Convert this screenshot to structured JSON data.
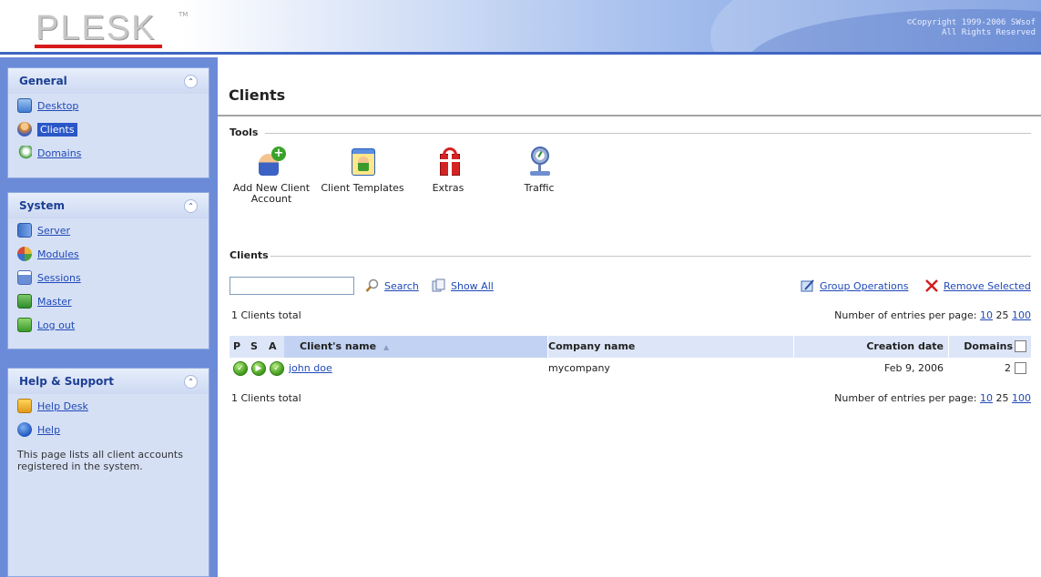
{
  "header": {
    "logo": "PLESK",
    "logo_tm": "TM",
    "copyright_line1": "©Copyright 1999-2006 SWsof",
    "copyright_line2": "All Rights Reserved"
  },
  "sidebar": {
    "general": {
      "title": "General",
      "items": [
        {
          "label": "Desktop",
          "icon": "desktop-icon"
        },
        {
          "label": "Clients",
          "icon": "clients-icon",
          "active": true
        },
        {
          "label": "Domains",
          "icon": "domains-icon"
        }
      ]
    },
    "system": {
      "title": "System",
      "items": [
        {
          "label": "Server",
          "icon": "server-icon"
        },
        {
          "label": "Modules",
          "icon": "modules-icon"
        },
        {
          "label": "Sessions",
          "icon": "sessions-icon"
        },
        {
          "label": "Master",
          "icon": "master-icon"
        },
        {
          "label": "Log out",
          "icon": "logout-icon"
        }
      ]
    },
    "help": {
      "title": "Help & Support",
      "items": [
        {
          "label": "Help Desk",
          "icon": "help-desk-icon"
        },
        {
          "label": "Help",
          "icon": "help-icon"
        }
      ],
      "description": "This page lists all client accounts registered in the system."
    }
  },
  "main": {
    "page_title": "Clients",
    "tools": {
      "label": "Tools",
      "items": [
        {
          "label": "Add New Client Account",
          "icon": "add-client-icon"
        },
        {
          "label": "Client Templates",
          "icon": "client-templates-icon"
        },
        {
          "label": "Extras",
          "icon": "extras-gift-icon"
        },
        {
          "label": "Traffic",
          "icon": "traffic-icon"
        }
      ]
    },
    "clients": {
      "label": "Clients",
      "search_value": "",
      "search_link": "Search",
      "show_all_link": "Show All",
      "group_operations": "Group Operations",
      "remove_selected": "Remove Selected",
      "total_top": "1 Clients total",
      "total_bottom": "1 Clients total",
      "per_page_label": "Number of entries per page:",
      "per_page_options": [
        "10",
        "25",
        "100"
      ],
      "per_page_current": "25",
      "columns": {
        "p": "P",
        "s": "S",
        "a": "A",
        "name": "Client's name",
        "company": "Company name",
        "created": "Creation date",
        "domains": "Domains"
      },
      "rows": [
        {
          "name": "john doe",
          "company": "mycompany",
          "created": "Feb 9, 2006",
          "domains": "2"
        }
      ]
    }
  },
  "colors": {
    "accent": "#2a57c8",
    "link": "#1f49b8",
    "sidebar_bg": "#6b8bd9",
    "panel_bg": "#d6e0f5",
    "logo_red": "#d71a1a"
  }
}
